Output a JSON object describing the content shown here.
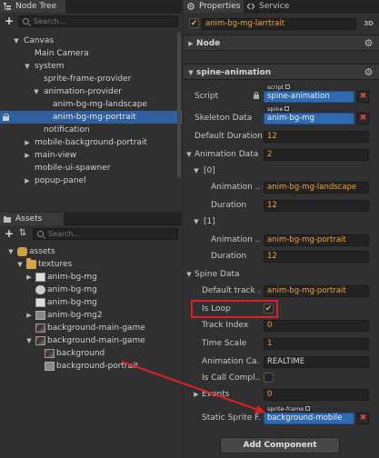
{
  "node_tree": {
    "tab_label": "Node Tree",
    "search_placeholder": "Search...",
    "items": [
      {
        "label": "Canvas"
      },
      {
        "label": "Main Camera"
      },
      {
        "label": "system"
      },
      {
        "label": "sprite-frame-provider"
      },
      {
        "label": "animation-provider"
      },
      {
        "label": "anim-bg-mg-landscape"
      },
      {
        "label": "anim-bg-mg-portrait"
      },
      {
        "label": "notification"
      },
      {
        "label": "mobile-background-portrait"
      },
      {
        "label": "main-view"
      },
      {
        "label": "mobile-ui-spawner"
      },
      {
        "label": "popup-panel"
      }
    ]
  },
  "assets": {
    "tab_label": "Assets",
    "search_placeholder": "Search...",
    "items": [
      {
        "label": "assets"
      },
      {
        "label": "textures"
      },
      {
        "label": "anim-bg-mg"
      },
      {
        "label": "anim-bg-mg"
      },
      {
        "label": "anim-bg-mg"
      },
      {
        "label": "anim-bg-mg2"
      },
      {
        "label": "background-main-game"
      },
      {
        "label": "background-main-game"
      },
      {
        "label": "background"
      },
      {
        "label": "background-portrait"
      }
    ]
  },
  "properties": {
    "tab_label": "Properties",
    "service_tab_label": "Service",
    "node_name": "anim-bg-mg-larrtrait",
    "badge_3d": "3D",
    "node_section": "Node",
    "component_section": "spine-animation",
    "script_label": "Script",
    "script_tag": "script",
    "script_value": "spine-animation",
    "skeleton_label": "Skeleton Data",
    "skeleton_tag": "spine",
    "skeleton_value": "anim-bg-mg",
    "default_duration_label": "Default Duration",
    "default_duration_value": "12",
    "animation_data_label": "Animation Data",
    "animation_data_count": "2",
    "item0_label": "[0]",
    "item0_animation_label": "Animation ...",
    "item0_animation_value": "anim-bg-mg-landscape",
    "item0_duration_label": "Duration",
    "item0_duration_value": "12",
    "item1_label": "[1]",
    "item1_animation_label": "Animation ...",
    "item1_animation_value": "anim-bg-mg-portrait",
    "item1_duration_label": "Duration",
    "item1_duration_value": "12",
    "spine_data_label": "Spine Data",
    "default_track_label": "Default track ...",
    "default_track_value": "anim-bg-mg-portrait",
    "is_loop_label": "Is Loop",
    "is_loop_check": "✔",
    "track_index_label": "Track Index",
    "track_index_value": "0",
    "time_scale_label": "Time Scale",
    "time_scale_value": "1",
    "animation_ca_label": "Animation Ca...",
    "animation_ca_value": "REALTIME",
    "is_call_label": "Is Call Compl...",
    "events_label": "Events",
    "events_value": "0",
    "static_sprite_label": "Static Sprite F...",
    "static_sprite_tag": "sprite-frame",
    "static_sprite_value": "background-mobile",
    "add_component_label": "Add Component"
  },
  "colors": {
    "accent": "#f0a030",
    "selection": "#2f5f9e",
    "annotation": "#e02020"
  }
}
